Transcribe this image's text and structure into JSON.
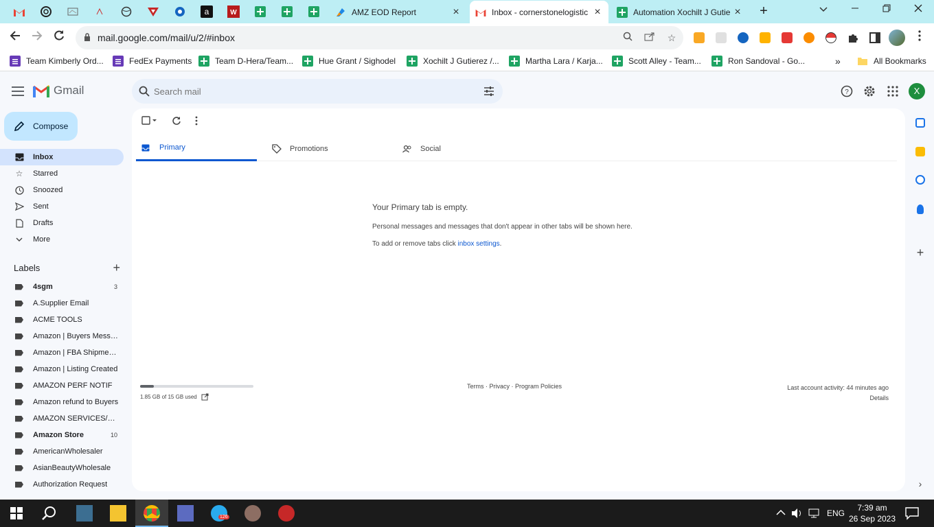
{
  "browser": {
    "tabs": [
      {
        "title": "AMZ EOD Report",
        "icon": "azure-devops-icon",
        "active": false
      },
      {
        "title": "Inbox - cornerstonelogistic",
        "icon": "gmail-icon",
        "active": true
      },
      {
        "title": "Automation Xochilt J Gutie",
        "icon": "sheets-icon",
        "active": false
      }
    ],
    "url": "mail.google.com/mail/u/2/#inbox",
    "bookmarks": [
      {
        "label": "Team Kimberly Ord...",
        "icon": "forms-icon"
      },
      {
        "label": "FedEx Payments",
        "icon": "forms-icon"
      },
      {
        "label": "Team D-Hera/Team...",
        "icon": "sheets-icon"
      },
      {
        "label": "Hue Grant / Sighodel",
        "icon": "sheets-icon"
      },
      {
        "label": "Xochilt J Gutierez /...",
        "icon": "sheets-icon"
      },
      {
        "label": "Martha Lara / Karja...",
        "icon": "sheets-icon"
      },
      {
        "label": "Scott Alley - Team...",
        "icon": "sheets-icon"
      },
      {
        "label": "Ron Sandoval - Go...",
        "icon": "sheets-icon"
      }
    ],
    "all_bookmarks": "All Bookmarks",
    "overflow": "»"
  },
  "gmail": {
    "logo_text": "Gmail",
    "search_placeholder": "Search mail",
    "avatar_letter": "X",
    "compose": "Compose",
    "nav": [
      {
        "label": "Inbox",
        "icon": "inbox-icon",
        "active": true
      },
      {
        "label": "Starred",
        "icon": "star-icon"
      },
      {
        "label": "Snoozed",
        "icon": "clock-icon"
      },
      {
        "label": "Sent",
        "icon": "send-icon"
      },
      {
        "label": "Drafts",
        "icon": "draft-icon"
      },
      {
        "label": "More",
        "icon": "chevron-down-icon"
      }
    ],
    "labels_title": "Labels",
    "labels": [
      {
        "name": "4sgm",
        "count": "3",
        "bold": true
      },
      {
        "name": "A.Supplier Email",
        "count": ""
      },
      {
        "name": "ACME TOOLS",
        "count": ""
      },
      {
        "name": "Amazon | Buyers Messa...",
        "count": ""
      },
      {
        "name": "Amazon | FBA Shipments",
        "count": ""
      },
      {
        "name": "Amazon | Listing Created",
        "count": ""
      },
      {
        "name": "AMAZON PERF NOTIF",
        "count": ""
      },
      {
        "name": "Amazon refund to Buyers",
        "count": ""
      },
      {
        "name": "AMAZON SERVICES/PAY...",
        "count": ""
      },
      {
        "name": "Amazon Store",
        "count": "10",
        "bold": true
      },
      {
        "name": "AmericanWholesaler",
        "count": ""
      },
      {
        "name": "AsianBeautyWholesale",
        "count": ""
      },
      {
        "name": "Authorization Request",
        "count": ""
      }
    ],
    "tabs": [
      {
        "label": "Primary",
        "icon": "inbox-icon",
        "active": true
      },
      {
        "label": "Promotions",
        "icon": "tag-icon"
      },
      {
        "label": "Social",
        "icon": "people-icon"
      }
    ],
    "empty_title": "Your Primary tab is empty.",
    "empty_desc": "Personal messages and messages that don't appear in other tabs will be shown here.",
    "empty_settings_prefix": "To add or remove tabs click ",
    "empty_settings_link": "inbox settings",
    "empty_settings_suffix": ".",
    "storage_text": "1.85 GB of 15 GB used",
    "storage_fraction": 0.123,
    "footer_links": "Terms · Privacy · Program Policies",
    "last_activity": "Last account activity: 44 minutes ago",
    "details": "Details"
  },
  "taskbar": {
    "telegram_badge": "126",
    "language": "ENG",
    "time": "7:39 am",
    "date": "26 Sep 2023"
  }
}
